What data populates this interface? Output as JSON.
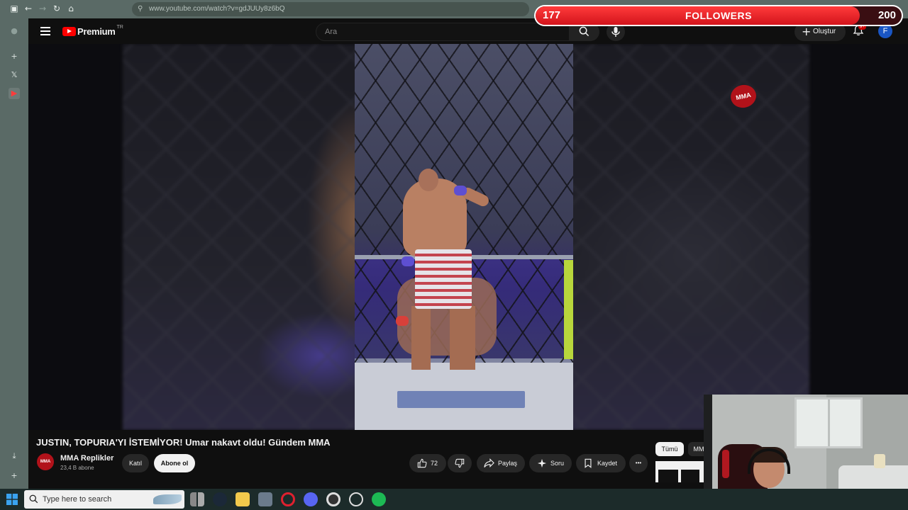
{
  "browser": {
    "url": "www.youtube.com/watch?v=gdJUUy8z6bQ"
  },
  "youtube": {
    "brand": "Premium",
    "region": "TR",
    "search_placeholder": "Ara",
    "create_label": "Oluştur",
    "notification_badge": "9+",
    "avatar_letter": "F"
  },
  "video": {
    "title": "JUSTIN, TOPURIA'YI İSTEMİYOR! Umar nakavt oldu! Gündem MMA",
    "watermark": "MMA"
  },
  "channel": {
    "name": "MMA Replikler",
    "subscribers": "23,4 B abone",
    "avatar_text": "MMA",
    "join_label": "Katıl",
    "subscribe_label": "Abone ol"
  },
  "actions": {
    "likes": "72",
    "share": "Paylaş",
    "ask": "Soru",
    "save": "Kaydet",
    "more": "•••"
  },
  "filters": {
    "all": "Tümü",
    "next": "MM"
  },
  "followers_overlay": {
    "current": "177",
    "label": "FOLLOWERS",
    "goal": "200",
    "progress": 0.885
  },
  "taskbar": {
    "search_placeholder": "Type here to search"
  },
  "colors": {
    "youtube_red": "#ff0000",
    "overlay_red": "#d3141c",
    "taskbar": "#1c2b2a",
    "browser_frame": "#5a6a66"
  }
}
